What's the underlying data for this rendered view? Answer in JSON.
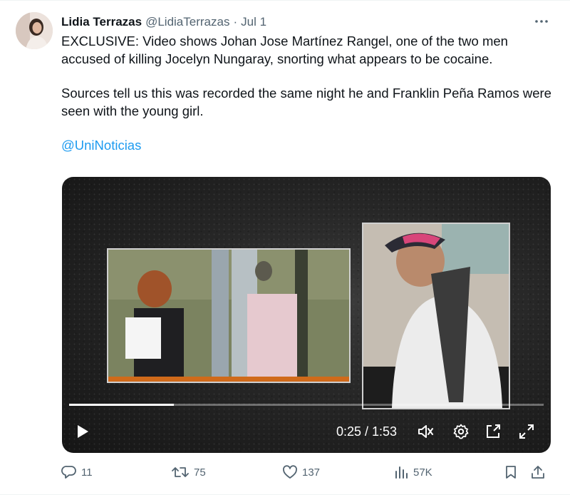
{
  "author": {
    "name": "Lidia Terrazas",
    "handle": "@LidiaTerrazas",
    "separator": "·",
    "date": "Jul 1"
  },
  "more_icon": "more-horizontal-icon",
  "text": {
    "para1": "EXCLUSIVE: Video shows Johan Jose Martínez Rangel, one of the two men accused of killing Jocelyn Nungaray, snorting what appears to be cocaine.",
    "para2": "Sources tell us this was recorded the same night he and Franklin Peña Ramos were seen with the young girl.",
    "mention": "@UniNoticias"
  },
  "video": {
    "time": "0:25 / 1:53",
    "progress": 0.22,
    "controls": [
      "play-icon",
      "volume-icon",
      "settings-icon",
      "pip-icon",
      "fullscreen-icon"
    ]
  },
  "actions": {
    "replies": "11",
    "retweets": "75",
    "likes": "137",
    "views": "57K"
  },
  "colors": {
    "link": "#1d9bf0",
    "secondary_text": "#536471"
  }
}
